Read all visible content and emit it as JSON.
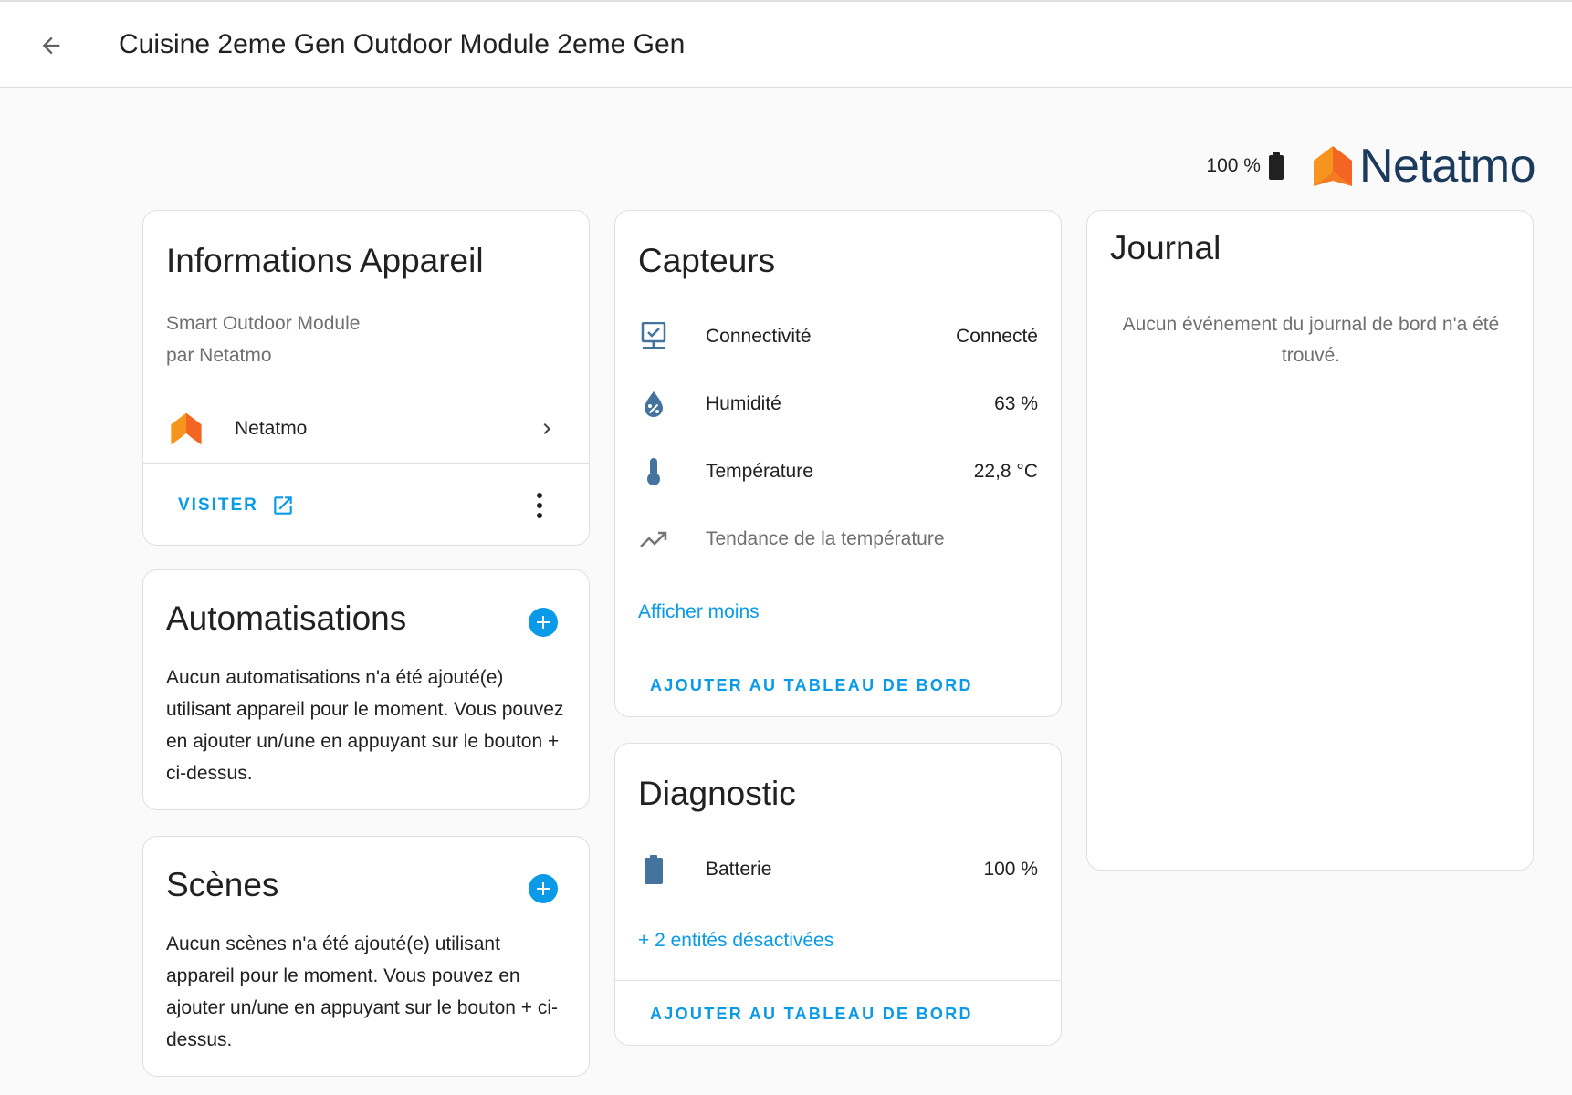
{
  "header": {
    "title": "Cuisine 2eme Gen Outdoor Module 2eme Gen"
  },
  "brand": {
    "battery_text": "100 %",
    "logo_text": "Netatmo",
    "logo_colors": {
      "orange": "#f7941d",
      "orange_dark": "#f26522",
      "text": "#1b3a5c"
    }
  },
  "device_info": {
    "title": "Informations Appareil",
    "model": "Smart Outdoor Module",
    "manufacturer": "par Netatmo",
    "integration": "Netatmo",
    "visit_label": "VISITER"
  },
  "automations": {
    "title": "Automatisations",
    "empty_text": "Aucun automatisations n'a été ajouté(e) utilisant appareil pour le moment. Vous pouvez en ajouter un/une en appuyant sur le bouton + ci-dessus."
  },
  "scenes": {
    "title": "Scènes",
    "empty_text": "Aucun scènes n'a été ajouté(e) utilisant appareil pour le moment. Vous pouvez en ajouter un/une en appuyant sur le bouton + ci-dessus."
  },
  "sensors": {
    "title": "Capteurs",
    "entities": [
      {
        "name": "Connectivité",
        "value": "Connecté",
        "icon": "connectivity-icon"
      },
      {
        "name": "Humidité",
        "value": "63 %",
        "icon": "humidity-icon"
      },
      {
        "name": "Température",
        "value": "22,8 °C",
        "icon": "thermometer-icon"
      },
      {
        "name": "Tendance de la température",
        "value": "",
        "icon": "trend-icon"
      }
    ],
    "show_less": "Afficher moins",
    "add_to_dashboard": "AJOUTER AU TABLEAU DE BORD"
  },
  "diagnostic": {
    "title": "Diagnostic",
    "entities": [
      {
        "name": "Batterie",
        "value": "100 %",
        "icon": "battery-icon"
      }
    ],
    "disabled_entities": "+ 2 entités désactivées",
    "add_to_dashboard": "AJOUTER AU TABLEAU DE BORD"
  },
  "logbook": {
    "title": "Journal",
    "empty_text": "Aucun événement du journal de bord n'a été trouvé."
  },
  "colors": {
    "accent": "#0a9ae8",
    "entity_icon": "#44739e",
    "background": "#fafafa",
    "card": "#ffffff"
  }
}
